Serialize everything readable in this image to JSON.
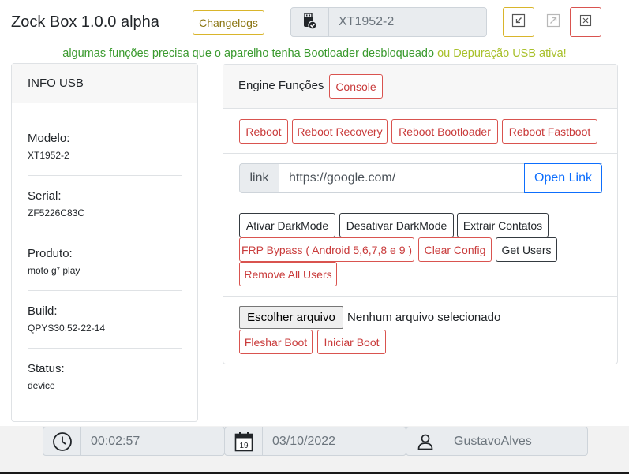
{
  "header": {
    "title": "Zock Box 1.0.0 alpha",
    "changelogs_label": "Changelogs",
    "device_name": "XT1952-2",
    "device_icon": "usb-device-check-icon",
    "window_buttons": [
      "restore-icon",
      "maximize-icon",
      "close-icon"
    ]
  },
  "warning": {
    "part1": "algumas funções precisa que o aparelho tenha Bootloader desbloqueado",
    "part2": " ou Depuração USB ativa!"
  },
  "info_usb": {
    "title": "INFO USB",
    "items": [
      {
        "label": "Modelo:",
        "value": "XT1952-2"
      },
      {
        "label": "Serial:",
        "value": "ZF5226C83C"
      },
      {
        "label": "Produto:",
        "value": "moto g⁷ play"
      },
      {
        "label": "Build:",
        "value": "QPYS30.52-22-14"
      },
      {
        "label": "Status:",
        "value": "device"
      }
    ]
  },
  "engine": {
    "title": "Engine Funções",
    "console_label": "Console",
    "reboot_buttons": [
      "Reboot",
      "Reboot Recovery",
      "Reboot Bootloader",
      "Reboot Fastboot"
    ],
    "link_addon": "link",
    "link_value": "https://google.com/",
    "open_link_label": "Open Link",
    "actions": {
      "ativar_darkmode": "Ativar DarkMode",
      "desativar_darkmode": "Desativar DarkMode",
      "extrair_contatos": "Extrair Contatos",
      "frp_bypass": "FRP Bypass ( Android 5,6,7,8 e 9 )",
      "clear_config": "Clear Config",
      "get_users": "Get Users",
      "remove_all_users": "Remove All Users"
    },
    "file_button": "Escolher arquivo",
    "file_status": "Nenhum arquivo selecionado",
    "fleshar_boot": "Fleshar Boot",
    "iniciar_boot": "Iniciar Boot"
  },
  "footer": {
    "time": "00:02:57",
    "date": "03/10/2022",
    "calendar_day": "19",
    "user": "GustavoAlves"
  },
  "colors": {
    "warning_green": "#3a9a2e",
    "warning_yellow": "#a8c02a",
    "danger": "#d9534f",
    "primary": "#0d6efd",
    "accent_yellow": "#d9b52b"
  }
}
